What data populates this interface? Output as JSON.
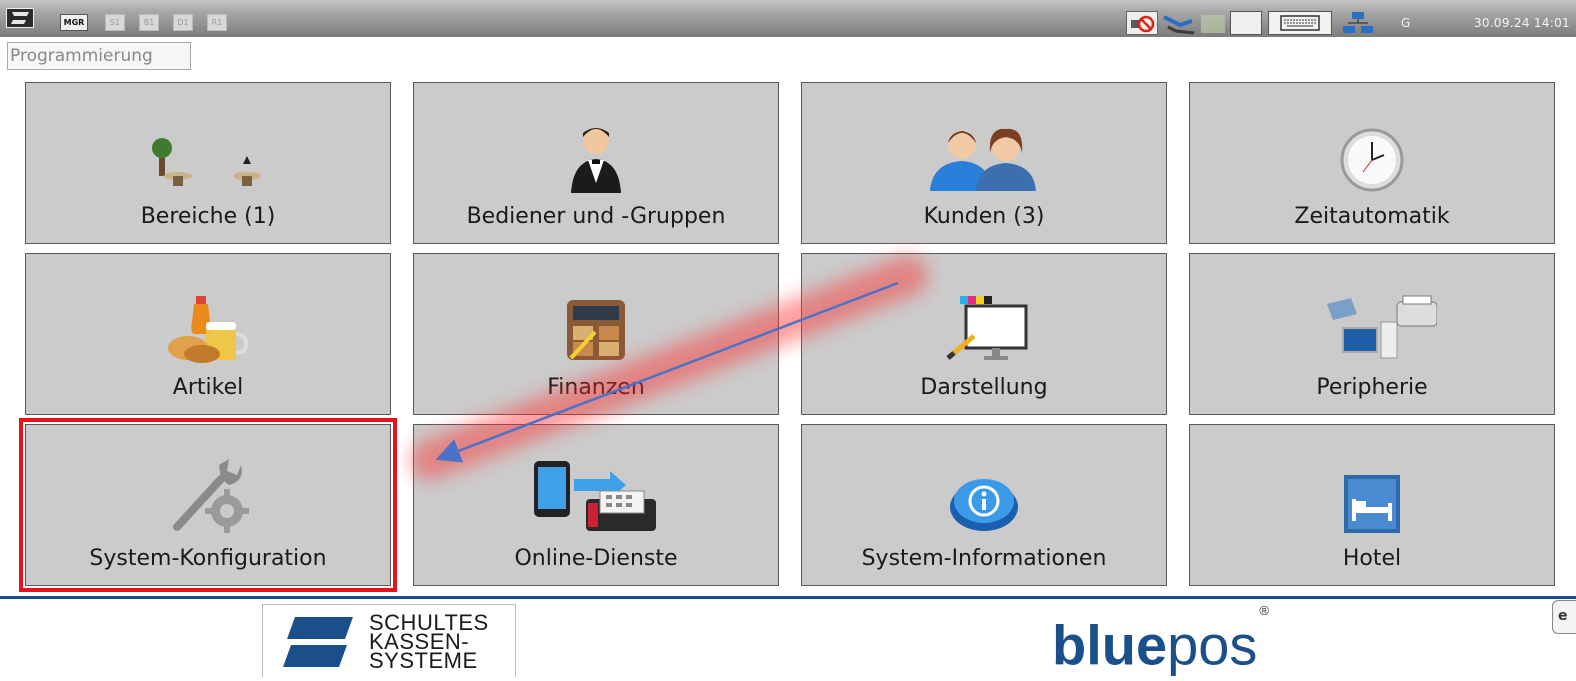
{
  "topbar": {
    "modes": [
      {
        "label": "MGR",
        "active": true
      },
      {
        "label": "S1",
        "active": false
      },
      {
        "label": "B1",
        "active": false
      },
      {
        "label": "D1",
        "active": false
      },
      {
        "label": "R1",
        "active": false
      }
    ],
    "network_label": "G",
    "datetime": "30.09.24  14:01"
  },
  "section_title": "Programmierung",
  "tiles": [
    {
      "label": "Bereiche (1)",
      "icon": "tables-icon"
    },
    {
      "label": "Bediener und -Gruppen",
      "icon": "waiter-icon"
    },
    {
      "label": "Kunden (3)",
      "icon": "customers-icon"
    },
    {
      "label": "Zeitautomatik",
      "icon": "clock-icon"
    },
    {
      "label": "Artikel",
      "icon": "food-drink-icon"
    },
    {
      "label": "Finanzen",
      "icon": "calculator-icon"
    },
    {
      "label": "Darstellung",
      "icon": "display-icon"
    },
    {
      "label": "Peripherie",
      "icon": "peripherals-icon"
    },
    {
      "label": "System-Konfiguration",
      "icon": "wrench-gear-icon",
      "highlighted": true
    },
    {
      "label": "Online-Dienste",
      "icon": "phone-fax-icon"
    },
    {
      "label": "System-Informationen",
      "icon": "info-icon"
    },
    {
      "label": "Hotel",
      "icon": "bed-icon"
    }
  ],
  "footer": {
    "company_lines": [
      "SCHULTES",
      "KASSEN-",
      "SYSTEME"
    ],
    "brand_bold": "blue",
    "brand_light": "pos",
    "brand_mark": "®"
  },
  "colors": {
    "tile_bg": "#cbcbcb",
    "highlight": "#e8121a",
    "brand_blue": "#1b4f8a",
    "arrow": "#4a72c8"
  }
}
